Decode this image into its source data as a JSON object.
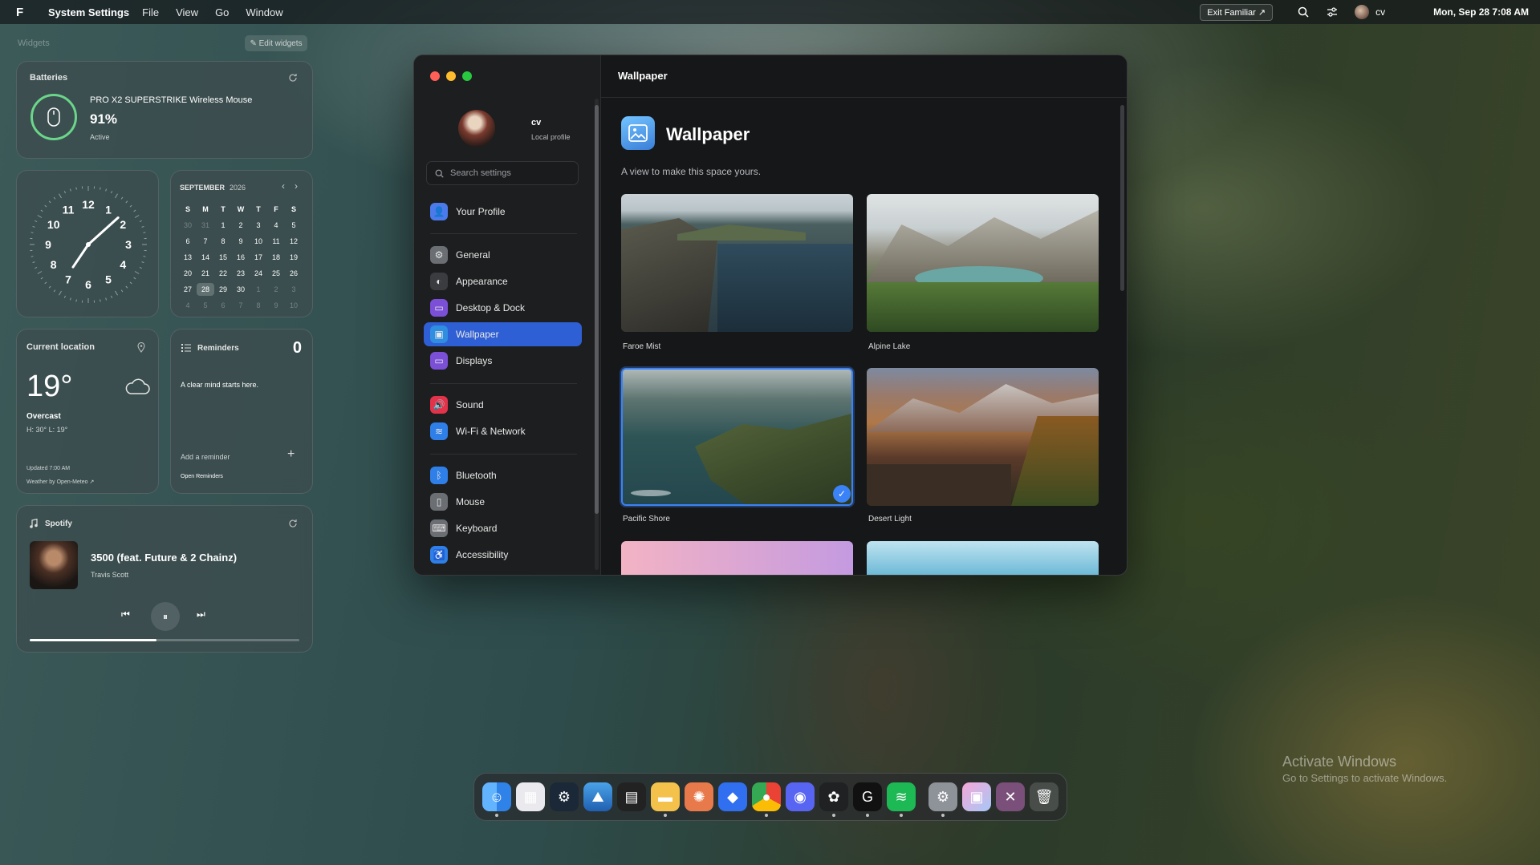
{
  "menubar": {
    "logo": "F",
    "app_name": "System Settings",
    "menus": [
      "File",
      "View",
      "Go",
      "Window"
    ],
    "exit_label": "Exit Familiar ↗",
    "user": "cv",
    "datetime": "Mon, Sep 28 7:08 AM"
  },
  "widgets_area": {
    "label": "Widgets",
    "edit_label": "✎ Edit widgets",
    "batteries": {
      "title": "Batteries",
      "device": "PRO X2 SUPERSTRIKE Wireless Mouse",
      "percent": "91%",
      "level": 0.91,
      "status": "Active"
    },
    "calendar": {
      "month": "SEPTEMBER",
      "year": "2026",
      "weekdays": [
        "S",
        "M",
        "T",
        "W",
        "T",
        "F",
        "S"
      ],
      "days": [
        "30",
        "31",
        "1",
        "2",
        "3",
        "4",
        "5",
        "6",
        "7",
        "8",
        "9",
        "10",
        "11",
        "12",
        "13",
        "14",
        "15",
        "16",
        "17",
        "18",
        "19",
        "20",
        "21",
        "22",
        "23",
        "24",
        "25",
        "26",
        "27",
        "28",
        "29",
        "30",
        "1",
        "2",
        "3",
        "4",
        "5",
        "6",
        "7",
        "8",
        "9",
        "10"
      ],
      "today": "28"
    },
    "clock": {
      "numbers": [
        "12",
        "1",
        "2",
        "3",
        "4",
        "5",
        "6",
        "7",
        "8",
        "9",
        "10",
        "11"
      ],
      "hour": 7,
      "minute": 8
    },
    "weather": {
      "title": "Current location",
      "temp": "19°",
      "condition": "Overcast",
      "hilo": "H: 30°  L: 19°",
      "updated": "Updated 7:00 AM",
      "source": "Weather by Open-Meteo ↗"
    },
    "reminders": {
      "title": "Reminders",
      "count": "0",
      "empty": "A clear mind starts here.",
      "add": "Add a reminder",
      "open": "Open Reminders"
    },
    "spotify": {
      "title": "Spotify",
      "track": "3500 (feat. Future & 2 Chainz)",
      "artist": "Travis Scott",
      "progress": 0.47
    }
  },
  "window": {
    "title": "Wallpaper",
    "profile": {
      "name": "cv",
      "subtitle": "Local profile"
    },
    "search_placeholder": "Search settings",
    "nav": [
      {
        "label": "Your Profile",
        "icon": "person-icon",
        "color": "#4b7bea"
      },
      {
        "label": "General",
        "icon": "gear-icon",
        "color": "#6b6e73"
      },
      {
        "label": "Appearance",
        "icon": "contrast-icon",
        "color": "#3a3c3f"
      },
      {
        "label": "Desktop & Dock",
        "icon": "monitor-icon",
        "color": "#7b4fd6"
      },
      {
        "label": "Wallpaper",
        "icon": "image-icon",
        "color": "#2f8ee0"
      },
      {
        "label": "Displays",
        "icon": "display-icon",
        "color": "#7b4fd6"
      },
      {
        "label": "Sound",
        "icon": "speaker-icon",
        "color": "#e2334a"
      },
      {
        "label": "Wi-Fi & Network",
        "icon": "wifi-icon",
        "color": "#2f7fe8"
      },
      {
        "label": "Bluetooth",
        "icon": "bluetooth-icon",
        "color": "#2f7fe8"
      },
      {
        "label": "Mouse",
        "icon": "mouse-icon",
        "color": "#6b6e73"
      },
      {
        "label": "Keyboard",
        "icon": "keyboard-icon",
        "color": "#6b6e73"
      },
      {
        "label": "Accessibility",
        "icon": "accessibility-icon",
        "color": "#2f7fe8"
      }
    ],
    "active_nav": "Wallpaper",
    "heading": "Wallpaper",
    "subtitle": "A view to make this space yours.",
    "wallpapers": [
      {
        "name": "Faroe Mist",
        "selected": false
      },
      {
        "name": "Alpine Lake",
        "selected": false
      },
      {
        "name": "Pacific Shore",
        "selected": true
      },
      {
        "name": "Desert Light",
        "selected": false
      }
    ]
  },
  "dock": {
    "apps": [
      "finder-icon",
      "launchpad-icon",
      "steam-icon",
      "photos-icon",
      "epic-icon",
      "files-icon",
      "claude-icon",
      "editor-icon",
      "chrome-icon",
      "discord-icon",
      "chatgpt-icon",
      "logitech-icon",
      "spotify-icon",
      "settings-icon",
      "gallery-icon",
      "close-app-icon",
      "trash-icon"
    ]
  },
  "watermark": {
    "title": "Activate Windows",
    "subtitle": "Go to Settings to activate Windows."
  }
}
